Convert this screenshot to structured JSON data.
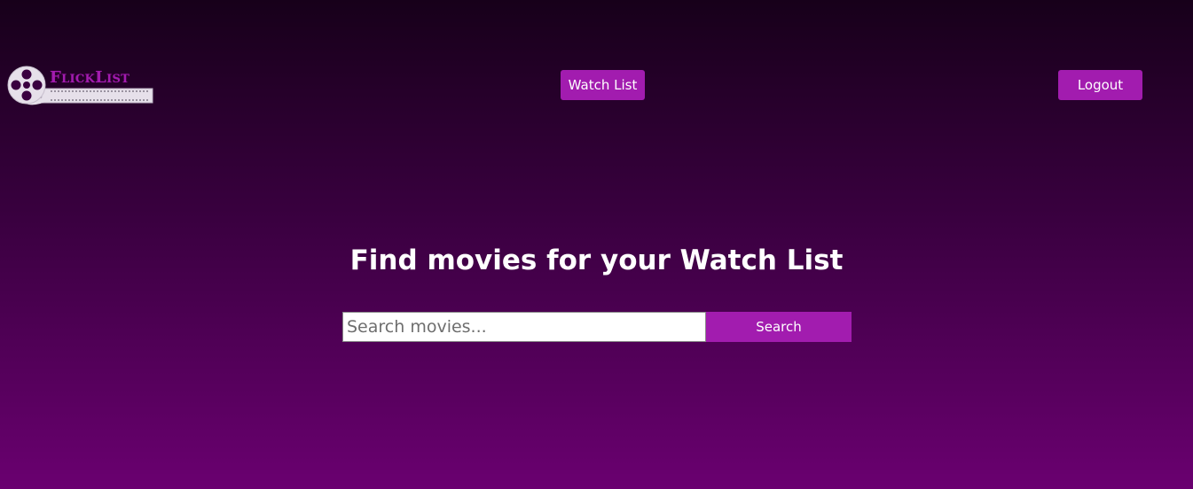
{
  "header": {
    "logo_text": "FlickList",
    "watch_list_label": "Watch List",
    "logout_label": "Logout"
  },
  "main": {
    "title": "Find movies for your Watch List",
    "search": {
      "placeholder": "Search movies...",
      "value": "",
      "button_label": "Search"
    }
  },
  "colors": {
    "accent": "#a21caf",
    "background_top": "#17001a",
    "background_bottom": "#6a0070"
  },
  "icons": {
    "logo": "film-reel-icon"
  }
}
